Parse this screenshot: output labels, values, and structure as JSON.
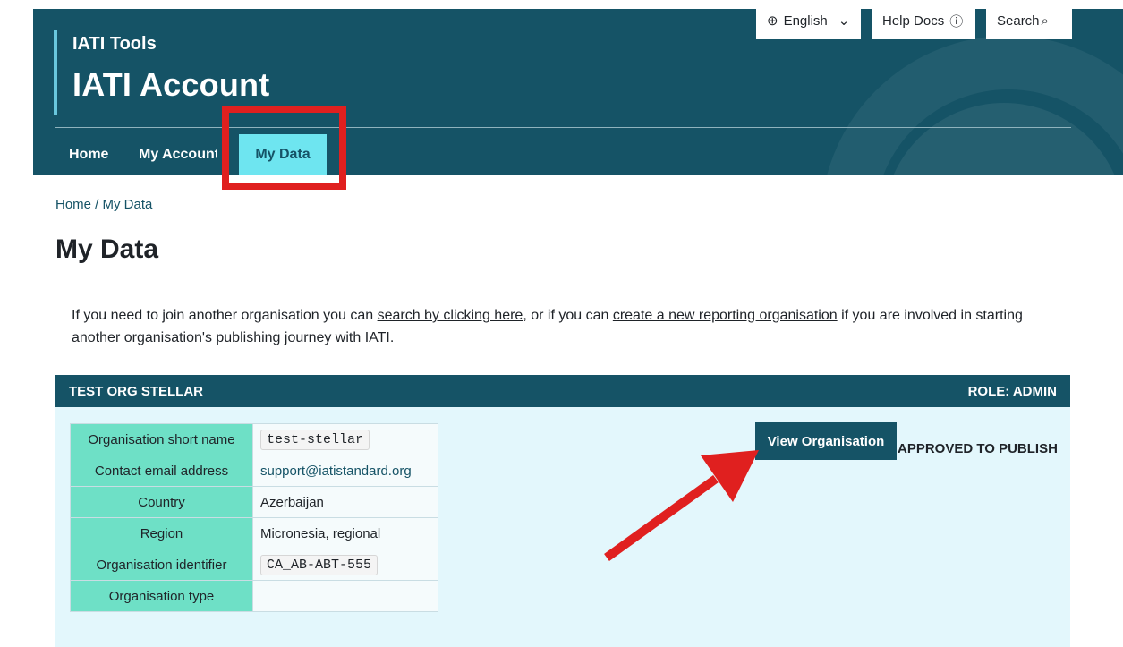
{
  "header": {
    "subtitle": "IATI Tools",
    "title": "IATI Account",
    "utility": {
      "language": "English",
      "help": "Help Docs",
      "search": "Search"
    },
    "nav": [
      "Home",
      "My Account",
      "My Data"
    ],
    "active_nav": "My Data"
  },
  "breadcrumb": "Home / My Data",
  "page_title": "My Data",
  "intro": {
    "text_1": "If you need to join another organisation you can ",
    "link_1": "search by clicking here",
    "text_2": ", or if you can ",
    "link_2": "create a new reporting organisation",
    "text_3": " if you are involved in starting another organisation's publishing journey with IATI."
  },
  "organisation": {
    "name": "TEST ORG STELLAR",
    "role": "ROLE: ADMIN",
    "view_button": "View Organisation",
    "status": "APPROVED TO PUBLISH",
    "details": [
      {
        "label": "Organisation short name",
        "value": "test-stellar",
        "code": true
      },
      {
        "label": "Contact email address",
        "value": "support@iatistandard.org",
        "email": true
      },
      {
        "label": "Country",
        "value": "Azerbaijan"
      },
      {
        "label": "Region",
        "value": "Micronesia, regional"
      },
      {
        "label": "Organisation identifier",
        "value": "CA_AB-ABT-555",
        "code": true
      },
      {
        "label": "Organisation type",
        "value": ""
      }
    ]
  },
  "colors": {
    "header": "#155366",
    "accent": "#6ee5f0",
    "table_label": "#6ee0c6",
    "annotation": "#e0201f"
  }
}
